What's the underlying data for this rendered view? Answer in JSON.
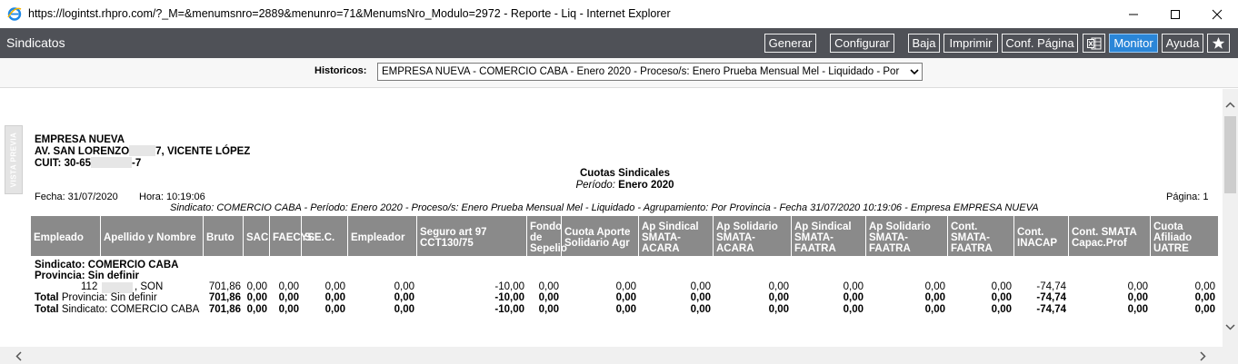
{
  "window": {
    "title": "https://logintst.rhpro.com/?_M=&menumsnro=2889&menunro=71&MenumsNro_Modulo=2972 - Reporte - Liq - Internet Explorer",
    "minimize_icon": "minimize-icon",
    "maximize_icon": "maximize-icon",
    "close_icon": "close-icon"
  },
  "app": {
    "title": "Sindicatos",
    "toolbar": {
      "generar": "Generar",
      "configurar": "Configurar",
      "baja": "Baja",
      "imprimir": "Imprimir",
      "conf_pagina": "Conf. Página",
      "excel_icon": "excel-icon",
      "monitor": "Monitor",
      "ayuda": "Ayuda",
      "star_icon": "star-icon"
    },
    "accent_color": "#2a86d8"
  },
  "historicos": {
    "label": "Historicos:",
    "selected": "EMPRESA NUEVA - COMERCIO CABA - Enero 2020 - Proceso/s: Enero Prueba Mensual Mel - Liquidado - Por"
  },
  "report": {
    "vista_previa": "VISTA PREVIA",
    "company": {
      "name": "EMPRESA NUEVA",
      "address_a": "AV. SAN LORENZO",
      "address_b": "7, VICENTE LÓPEZ",
      "cuit_a": "CUIT: 30-65",
      "cuit_b": "-7"
    },
    "title": "Cuotas Sindicales",
    "periodo_label": "Período:",
    "periodo_value": "Enero 2020",
    "fecha": "Fecha: 31/07/2020",
    "hora": "Hora: 10:19:06",
    "pagina": "Página: 1",
    "filter_line": "Sindicato: COMERCIO CABA - Período: Enero 2020 - Proceso/s: Enero Prueba Mensual Mel - Liquidado - Agrupamiento: Por Provincia - Fecha 31/07/2020 10:19:06 - Empresa EMPRESA NUEVA",
    "columns": [
      "Empleado",
      "Apellido y Nombre",
      "Bruto",
      "SAC",
      "FAECYS",
      "S.E.C.",
      "Empleador",
      "Seguro art 97 CCT130/75",
      "Fondo de Sepelio",
      "Cuota Aporte Solidario Agr",
      "Ap Sindical SMATA-ACARA",
      "Ap Solidario SMATA-ACARA",
      "Ap Sindical SMATA-FAATRA",
      "Ap Solidario SMATA-FAATRA",
      "Cont. SMATA-FAATRA",
      "Cont. INACAP",
      "Cont. SMATA Capac.Prof",
      "Cuota Afiliado UATRE"
    ],
    "group_sindicato": "Sindicato: COMERCIO CABA",
    "group_provincia": "Provincia: Sin definir",
    "rows": [
      {
        "empleado": "112",
        "nombre": ", SON",
        "values": [
          "701,86",
          "0,00",
          "0,00",
          "0,00",
          "0,00",
          "-10,00",
          "0,00",
          "0,00",
          "0,00",
          "0,00",
          "0,00",
          "0,00",
          "0,00",
          "-74,74",
          "0,00",
          "0,00"
        ]
      }
    ],
    "total_provincia": {
      "label": "Total",
      "sub": "Provincia: Sin definir",
      "values": [
        "701,86",
        "0,00",
        "0,00",
        "0,00",
        "0,00",
        "-10,00",
        "0,00",
        "0,00",
        "0,00",
        "0,00",
        "0,00",
        "0,00",
        "0,00",
        "-74,74",
        "0,00",
        "0,00"
      ]
    },
    "total_sindicato": {
      "label": "Total",
      "sub": "Sindicato: COMERCIO CABA",
      "values": [
        "701,86",
        "0,00",
        "0,00",
        "0,00",
        "0,00",
        "-10,00",
        "0,00",
        "0,00",
        "0,00",
        "0,00",
        "0,00",
        "0,00",
        "0,00",
        "-74,74",
        "0,00",
        "0,00"
      ]
    }
  }
}
